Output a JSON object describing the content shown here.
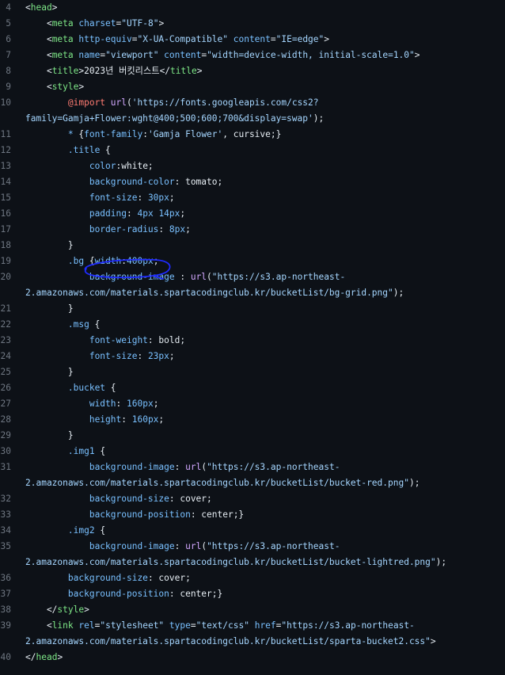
{
  "code": {
    "line_number_4": "4",
    "lines": [
      {
        "n": "4",
        "segments": [
          {
            "t": "<",
            "c": "c-punct"
          },
          {
            "t": "head",
            "c": "c-tag"
          },
          {
            "t": ">",
            "c": "c-punct"
          }
        ]
      },
      {
        "n": "5",
        "segments": [
          {
            "t": "    <",
            "c": "c-punct"
          },
          {
            "t": "meta",
            "c": "c-tag"
          },
          {
            "t": " charset",
            "c": "c-attr"
          },
          {
            "t": "=",
            "c": "c-punct"
          },
          {
            "t": "\"UTF-8\"",
            "c": "c-str"
          },
          {
            "t": ">",
            "c": "c-punct"
          }
        ]
      },
      {
        "n": "6",
        "segments": [
          {
            "t": "    <",
            "c": "c-punct"
          },
          {
            "t": "meta",
            "c": "c-tag"
          },
          {
            "t": " http-equiv",
            "c": "c-attr"
          },
          {
            "t": "=",
            "c": "c-punct"
          },
          {
            "t": "\"X-UA-Compatible\"",
            "c": "c-str"
          },
          {
            "t": " content",
            "c": "c-attr"
          },
          {
            "t": "=",
            "c": "c-punct"
          },
          {
            "t": "\"IE=edge\"",
            "c": "c-str"
          },
          {
            "t": ">",
            "c": "c-punct"
          }
        ]
      },
      {
        "n": "7",
        "segments": [
          {
            "t": "    <",
            "c": "c-punct"
          },
          {
            "t": "meta",
            "c": "c-tag"
          },
          {
            "t": " name",
            "c": "c-attr"
          },
          {
            "t": "=",
            "c": "c-punct"
          },
          {
            "t": "\"viewport\"",
            "c": "c-str"
          },
          {
            "t": " content",
            "c": "c-attr"
          },
          {
            "t": "=",
            "c": "c-punct"
          },
          {
            "t": "\"width=device-width, initial-scale=1.0\"",
            "c": "c-str"
          },
          {
            "t": ">",
            "c": "c-punct"
          }
        ]
      },
      {
        "n": "8",
        "segments": [
          {
            "t": "    <",
            "c": "c-punct"
          },
          {
            "t": "title",
            "c": "c-tag"
          },
          {
            "t": ">",
            "c": "c-punct"
          },
          {
            "t": "2023년 버킷리스트",
            "c": "c-text"
          },
          {
            "t": "</",
            "c": "c-punct"
          },
          {
            "t": "title",
            "c": "c-tag"
          },
          {
            "t": ">",
            "c": "c-punct"
          }
        ]
      },
      {
        "n": "9",
        "segments": [
          {
            "t": "    <",
            "c": "c-punct"
          },
          {
            "t": "style",
            "c": "c-tag"
          },
          {
            "t": ">",
            "c": "c-punct"
          }
        ]
      },
      {
        "n": "10",
        "segments": [
          {
            "t": "        ",
            "c": "c-text"
          },
          {
            "t": "@import",
            "c": "c-atrule"
          },
          {
            "t": " ",
            "c": "c-text"
          },
          {
            "t": "url",
            "c": "c-func"
          },
          {
            "t": "(",
            "c": "c-punct"
          },
          {
            "t": "'https://fonts.googleapis.com/css2?",
            "c": "c-str"
          }
        ]
      },
      {
        "n": "",
        "segments": [
          {
            "t": "family=Gamja+Flower:wght@400;500;600;700&display=swap'",
            "c": "c-str"
          },
          {
            "t": ");",
            "c": "c-punct"
          }
        ]
      },
      {
        "n": "11",
        "segments": [
          {
            "t": "        ",
            "c": "c-text"
          },
          {
            "t": "* ",
            "c": "c-sel"
          },
          {
            "t": "{",
            "c": "c-punct"
          },
          {
            "t": "font-family",
            "c": "c-prop"
          },
          {
            "t": ":",
            "c": "c-punct"
          },
          {
            "t": "'Gamja Flower'",
            "c": "c-str"
          },
          {
            "t": ", cursive;}",
            "c": "c-text"
          }
        ]
      },
      {
        "n": "12",
        "segments": [
          {
            "t": "        ",
            "c": "c-text"
          },
          {
            "t": ".title",
            "c": "c-sel"
          },
          {
            "t": " {",
            "c": "c-punct"
          }
        ]
      },
      {
        "n": "13",
        "segments": [
          {
            "t": "            ",
            "c": "c-text"
          },
          {
            "t": "color",
            "c": "c-prop"
          },
          {
            "t": ":white;",
            "c": "c-text"
          }
        ]
      },
      {
        "n": "14",
        "segments": [
          {
            "t": "            ",
            "c": "c-text"
          },
          {
            "t": "background-color",
            "c": "c-prop"
          },
          {
            "t": ": tomato;",
            "c": "c-text"
          }
        ]
      },
      {
        "n": "15",
        "segments": [
          {
            "t": "            ",
            "c": "c-text"
          },
          {
            "t": "font-size",
            "c": "c-prop"
          },
          {
            "t": ": ",
            "c": "c-text"
          },
          {
            "t": "30px",
            "c": "c-num"
          },
          {
            "t": ";",
            "c": "c-text"
          }
        ]
      },
      {
        "n": "16",
        "segments": [
          {
            "t": "            ",
            "c": "c-text"
          },
          {
            "t": "padding",
            "c": "c-prop"
          },
          {
            "t": ": ",
            "c": "c-text"
          },
          {
            "t": "4px",
            "c": "c-num"
          },
          {
            "t": " ",
            "c": "c-text"
          },
          {
            "t": "14px",
            "c": "c-num"
          },
          {
            "t": ";",
            "c": "c-text"
          }
        ]
      },
      {
        "n": "17",
        "segments": [
          {
            "t": "            ",
            "c": "c-text"
          },
          {
            "t": "border-radius",
            "c": "c-prop"
          },
          {
            "t": ": ",
            "c": "c-text"
          },
          {
            "t": "8px",
            "c": "c-num"
          },
          {
            "t": ";",
            "c": "c-text"
          }
        ]
      },
      {
        "n": "18",
        "segments": [
          {
            "t": "        }",
            "c": "c-text"
          }
        ]
      },
      {
        "n": "19",
        "segments": [
          {
            "t": "        ",
            "c": "c-text"
          },
          {
            "t": ".bg",
            "c": "c-sel"
          },
          {
            "t": " {",
            "c": "c-punct"
          },
          {
            "t": "width",
            "c": "c-prop"
          },
          {
            "t": ":",
            "c": "c-text"
          },
          {
            "t": "400px",
            "c": "c-num"
          },
          {
            "t": ";",
            "c": "c-text"
          }
        ]
      },
      {
        "n": "20",
        "segments": [
          {
            "t": "            ",
            "c": "c-text"
          },
          {
            "t": "background-image",
            "c": "c-prop"
          },
          {
            "t": " : ",
            "c": "c-text"
          },
          {
            "t": "url",
            "c": "c-func"
          },
          {
            "t": "(",
            "c": "c-punct"
          },
          {
            "t": "\"https://s3.ap-northeast-",
            "c": "c-str"
          }
        ]
      },
      {
        "n": "",
        "segments": [
          {
            "t": "2.amazonaws.com/materials.spartacodingclub.kr/bucketList/bg-grid.png\"",
            "c": "c-str"
          },
          {
            "t": ");",
            "c": "c-text"
          }
        ]
      },
      {
        "n": "21",
        "segments": [
          {
            "t": "        }",
            "c": "c-text"
          }
        ]
      },
      {
        "n": "22",
        "segments": [
          {
            "t": "        ",
            "c": "c-text"
          },
          {
            "t": ".msg",
            "c": "c-sel"
          },
          {
            "t": " {",
            "c": "c-punct"
          }
        ]
      },
      {
        "n": "23",
        "segments": [
          {
            "t": "            ",
            "c": "c-text"
          },
          {
            "t": "font-weight",
            "c": "c-prop"
          },
          {
            "t": ": bold;",
            "c": "c-text"
          }
        ]
      },
      {
        "n": "24",
        "segments": [
          {
            "t": "            ",
            "c": "c-text"
          },
          {
            "t": "font-size",
            "c": "c-prop"
          },
          {
            "t": ": ",
            "c": "c-text"
          },
          {
            "t": "23px",
            "c": "c-num"
          },
          {
            "t": ";",
            "c": "c-text"
          }
        ]
      },
      {
        "n": "25",
        "segments": [
          {
            "t": "        }",
            "c": "c-text"
          }
        ]
      },
      {
        "n": "26",
        "segments": [
          {
            "t": "        ",
            "c": "c-text"
          },
          {
            "t": ".bucket",
            "c": "c-sel"
          },
          {
            "t": " {",
            "c": "c-punct"
          }
        ]
      },
      {
        "n": "27",
        "segments": [
          {
            "t": "            ",
            "c": "c-text"
          },
          {
            "t": "width",
            "c": "c-prop"
          },
          {
            "t": ": ",
            "c": "c-text"
          },
          {
            "t": "160px",
            "c": "c-num"
          },
          {
            "t": ";",
            "c": "c-text"
          }
        ]
      },
      {
        "n": "28",
        "segments": [
          {
            "t": "            ",
            "c": "c-text"
          },
          {
            "t": "height",
            "c": "c-prop"
          },
          {
            "t": ": ",
            "c": "c-text"
          },
          {
            "t": "160px",
            "c": "c-num"
          },
          {
            "t": ";",
            "c": "c-text"
          }
        ]
      },
      {
        "n": "29",
        "segments": [
          {
            "t": "        }",
            "c": "c-text"
          }
        ]
      },
      {
        "n": "30",
        "segments": [
          {
            "t": "        ",
            "c": "c-text"
          },
          {
            "t": ".img1",
            "c": "c-sel"
          },
          {
            "t": " {",
            "c": "c-punct"
          }
        ]
      },
      {
        "n": "31",
        "segments": [
          {
            "t": "            ",
            "c": "c-text"
          },
          {
            "t": "background-image",
            "c": "c-prop"
          },
          {
            "t": ": ",
            "c": "c-text"
          },
          {
            "t": "url",
            "c": "c-func"
          },
          {
            "t": "(",
            "c": "c-punct"
          },
          {
            "t": "\"https://s3.ap-northeast-",
            "c": "c-str"
          }
        ]
      },
      {
        "n": "",
        "segments": [
          {
            "t": "2.amazonaws.com/materials.spartacodingclub.kr/bucketList/bucket-red.png\"",
            "c": "c-str"
          },
          {
            "t": ");",
            "c": "c-text"
          }
        ]
      },
      {
        "n": "32",
        "segments": [
          {
            "t": "            ",
            "c": "c-text"
          },
          {
            "t": "background-size",
            "c": "c-prop"
          },
          {
            "t": ": cover;",
            "c": "c-text"
          }
        ]
      },
      {
        "n": "33",
        "segments": [
          {
            "t": "            ",
            "c": "c-text"
          },
          {
            "t": "background-position",
            "c": "c-prop"
          },
          {
            "t": ": center;}",
            "c": "c-text"
          }
        ]
      },
      {
        "n": "34",
        "segments": [
          {
            "t": "        ",
            "c": "c-text"
          },
          {
            "t": ".img2",
            "c": "c-sel"
          },
          {
            "t": " {",
            "c": "c-punct"
          }
        ]
      },
      {
        "n": "35",
        "segments": [
          {
            "t": "            ",
            "c": "c-text"
          },
          {
            "t": "background-image",
            "c": "c-prop"
          },
          {
            "t": ": ",
            "c": "c-text"
          },
          {
            "t": "url",
            "c": "c-func"
          },
          {
            "t": "(",
            "c": "c-punct"
          },
          {
            "t": "\"https://s3.ap-northeast-",
            "c": "c-str"
          }
        ]
      },
      {
        "n": "",
        "segments": [
          {
            "t": "2.amazonaws.com/materials.spartacodingclub.kr/bucketList/bucket-lightred.png\"",
            "c": "c-str"
          },
          {
            "t": ");",
            "c": "c-text"
          }
        ]
      },
      {
        "n": "36",
        "segments": [
          {
            "t": "        ",
            "c": "c-text"
          },
          {
            "t": "background-size",
            "c": "c-prop"
          },
          {
            "t": ": cover;",
            "c": "c-text"
          }
        ]
      },
      {
        "n": "37",
        "segments": [
          {
            "t": "        ",
            "c": "c-text"
          },
          {
            "t": "background-position",
            "c": "c-prop"
          },
          {
            "t": ": center;}",
            "c": "c-text"
          }
        ]
      },
      {
        "n": "38",
        "segments": [
          {
            "t": "    </",
            "c": "c-punct"
          },
          {
            "t": "style",
            "c": "c-tag"
          },
          {
            "t": ">",
            "c": "c-punct"
          }
        ]
      },
      {
        "n": "39",
        "segments": [
          {
            "t": "    <",
            "c": "c-punct"
          },
          {
            "t": "link",
            "c": "c-tag"
          },
          {
            "t": " rel",
            "c": "c-attr"
          },
          {
            "t": "=",
            "c": "c-punct"
          },
          {
            "t": "\"stylesheet\"",
            "c": "c-str"
          },
          {
            "t": " type",
            "c": "c-attr"
          },
          {
            "t": "=",
            "c": "c-punct"
          },
          {
            "t": "\"text/css\"",
            "c": "c-str"
          },
          {
            "t": " href",
            "c": "c-attr"
          },
          {
            "t": "=",
            "c": "c-punct"
          },
          {
            "t": "\"https://s3.ap-northeast-",
            "c": "c-str"
          }
        ]
      },
      {
        "n": "",
        "segments": [
          {
            "t": "2.amazonaws.com/materials.spartacodingclub.kr/bucketList/sparta-bucket2.css\"",
            "c": "c-str"
          },
          {
            "t": ">",
            "c": "c-punct"
          }
        ]
      },
      {
        "n": "40",
        "segments": [
          {
            "t": "</",
            "c": "c-punct"
          },
          {
            "t": "head",
            "c": "c-tag"
          },
          {
            "t": ">",
            "c": "c-punct"
          }
        ]
      }
    ]
  },
  "colors": {
    "background": "#0d1117",
    "line_number": "#6e7681",
    "tag": "#7ee787",
    "attribute": "#79c0ff",
    "string": "#a5d6ff",
    "at_rule": "#ff7b72",
    "function": "#d2a8ff",
    "annotation": "#1f2bff"
  },
  "annotation": {
    "type": "hand-drawn-circle",
    "target_line": "19"
  }
}
